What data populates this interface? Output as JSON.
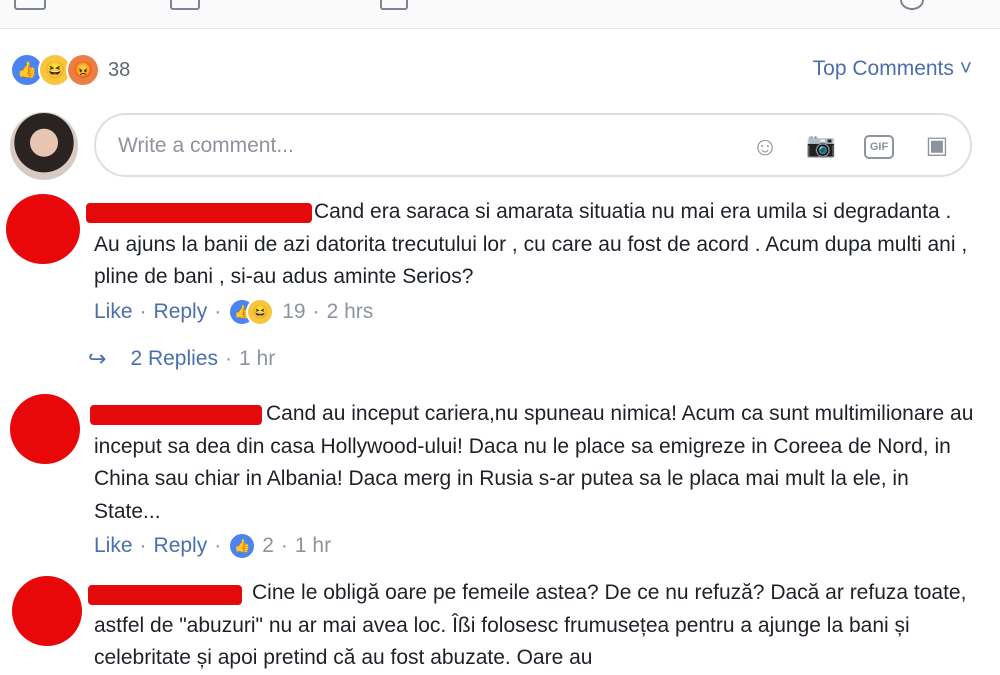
{
  "reactions": {
    "count": "38",
    "icons": [
      "like-icon",
      "haha-icon",
      "angry-icon"
    ]
  },
  "sort": {
    "label": "Top Comments ˅"
  },
  "composer": {
    "placeholder": "Write a comment...",
    "tools": [
      "emoji-icon",
      "camera-icon",
      "gif-icon",
      "sticker-icon"
    ]
  },
  "comments": [
    {
      "text": "Cand era saraca si amarata situatia nu mai era umila si degradanta . Au ajuns la banii de azi datorita trecutului lor , cu care au fost de acord . Acum dupa multi ani , pline de bani , si-au adus aminte Serios?",
      "like": "Like",
      "reply": "Reply",
      "reaction_count": "19",
      "time": "2 hrs"
    },
    {
      "text": "Cand au inceput cariera,nu spuneau nimica! Acum ca sunt multimilionare au inceput sa dea din casa Hollywood-ului! Daca nu le place sa emigreze in Coreea de Nord, in China sau chiar in Albania! Daca merg in Rusia s-ar putea sa le placa mai mult la ele, in State...",
      "like": "Like",
      "reply": "Reply",
      "reaction_count": "2",
      "time": "1 hr"
    },
    {
      "text": "Cine le obligă oare pe femeile astea? De ce nu refuză? Dacă ar refuza toate, astfel de \"abuzuri\" nu ar mai avea loc. Îßi folosesc frumusețea pentru a ajunge la bani și celebritate și apoi pretind că au fost abuzate. Oare au"
    }
  ],
  "replies_link": {
    "label": "2 Replies",
    "time": "1 hr"
  },
  "colors": {
    "link": "#4b6fad",
    "muted": "#8d949e",
    "redaction": "#e4090a"
  }
}
